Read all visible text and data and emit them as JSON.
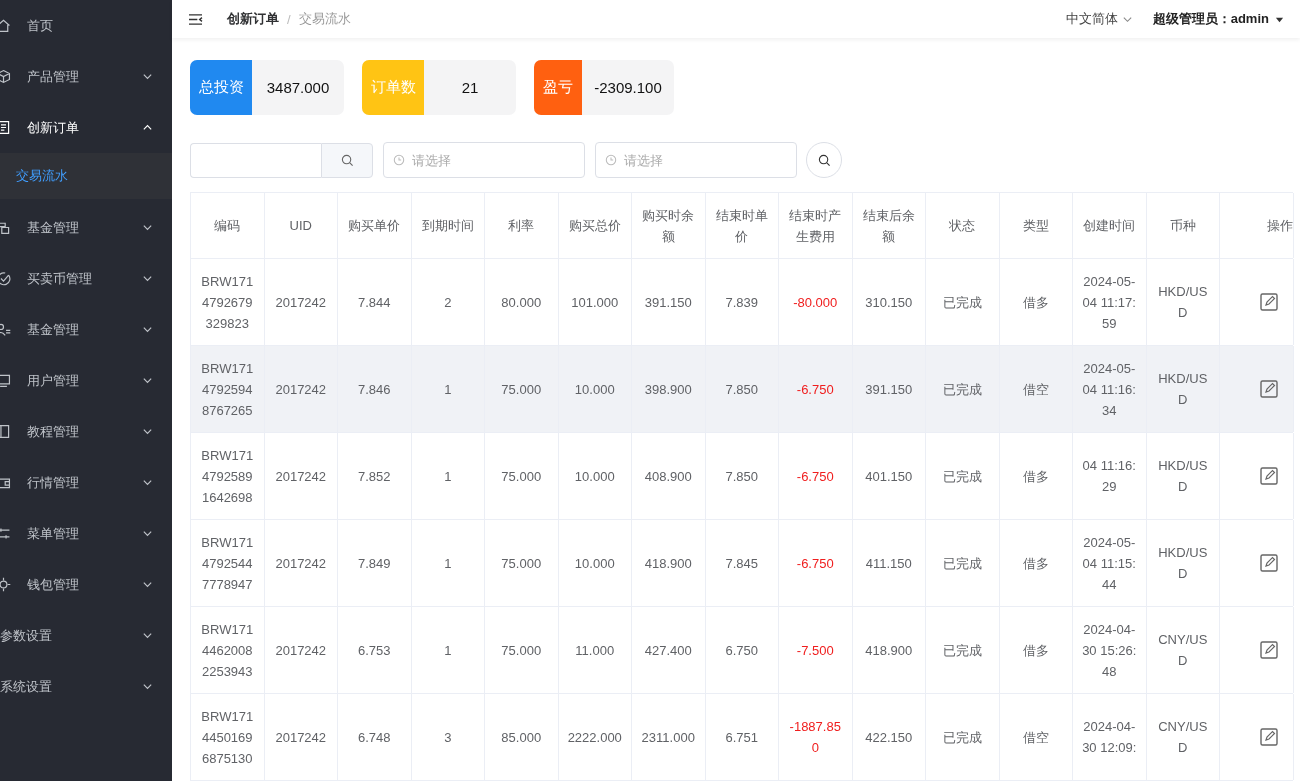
{
  "sidebar": {
    "items": [
      {
        "label": "首页",
        "expanded": false,
        "kind": "link"
      },
      {
        "label": "产品管理",
        "expanded": false,
        "kind": "submenu"
      },
      {
        "label": "创新订单",
        "expanded": true,
        "kind": "submenu",
        "children": [
          {
            "label": "交易流水",
            "selected": true
          }
        ]
      },
      {
        "label": "基金管理",
        "expanded": false,
        "kind": "submenu"
      },
      {
        "label": "买卖币管理",
        "expanded": false,
        "kind": "submenu"
      },
      {
        "label": "基金管理",
        "expanded": false,
        "kind": "submenu"
      },
      {
        "label": "用户管理",
        "expanded": false,
        "kind": "submenu"
      },
      {
        "label": "教程管理",
        "expanded": false,
        "kind": "submenu"
      },
      {
        "label": "行情管理",
        "expanded": false,
        "kind": "submenu"
      },
      {
        "label": "菜单管理",
        "expanded": false,
        "kind": "submenu"
      },
      {
        "label": "钱包管理",
        "expanded": false,
        "kind": "submenu"
      },
      {
        "label": "参数设置",
        "expanded": false,
        "kind": "submenu"
      },
      {
        "label": "系统设置",
        "expanded": false,
        "kind": "submenu"
      }
    ]
  },
  "breadcrumb": {
    "items": [
      "创新订单",
      "交易流水"
    ],
    "separator": "/"
  },
  "header": {
    "language": "中文简体",
    "user": "超级管理员：admin"
  },
  "stats": [
    {
      "label": "总投资",
      "value": "3487.000",
      "color": "#2089f0"
    },
    {
      "label": "订单数",
      "value": "21",
      "color": "#ffc414"
    },
    {
      "label": "盈亏",
      "value": "-2309.100",
      "color": "#ff6010"
    }
  ],
  "filters": {
    "date_start": {
      "placeholder": "请选择"
    },
    "date_end": {
      "placeholder": "请选择"
    }
  },
  "table": {
    "columns": [
      "编码",
      "UID",
      "购买单价",
      "到期时间",
      "利率",
      "购买总价",
      "购买时余额",
      "结束时单价",
      "结束时产生费用",
      "结束后余额",
      "状态",
      "类型",
      "创建时间",
      "币种",
      "操作"
    ],
    "rows": [
      {
        "highlighted": false,
        "cells": [
          "BRW1714792679329823",
          "2017242",
          "7.844",
          "2",
          "80.000",
          "101.000",
          "391.150",
          "7.839",
          "-80.000",
          "310.150",
          "已完成",
          "借多",
          "2024-05-04 11:17:59",
          "HKD/USD"
        ]
      },
      {
        "highlighted": true,
        "cells": [
          "BRW17147925948767265",
          "2017242",
          "7.846",
          "1",
          "75.000",
          "10.000",
          "398.900",
          "7.850",
          "-6.750",
          "391.150",
          "已完成",
          "借空",
          "2024-05-04 11:16:34",
          "HKD/USD"
        ]
      },
      {
        "highlighted": false,
        "cells": [
          "BRW17147925891642698",
          "2017242",
          "7.852",
          "1",
          "75.000",
          "10.000",
          "408.900",
          "7.850",
          "-6.750",
          "401.150",
          "已完成",
          "借多",
          "04 11:16:29",
          "HKD/USD"
        ]
      },
      {
        "highlighted": false,
        "cells": [
          "BRW17147925447778947",
          "2017242",
          "7.849",
          "1",
          "75.000",
          "10.000",
          "418.900",
          "7.845",
          "-6.750",
          "411.150",
          "已完成",
          "借多",
          "2024-05-04 11:15:44",
          "HKD/USD"
        ]
      },
      {
        "highlighted": false,
        "cells": [
          "BRW17144620082253943",
          "2017242",
          "6.753",
          "1",
          "75.000",
          "11.000",
          "427.400",
          "6.750",
          "-7.500",
          "418.900",
          "已完成",
          "借多",
          "2024-04-30 15:26:48",
          "CNY/USD"
        ]
      },
      {
        "highlighted": false,
        "cells": [
          "BRW17144501696875130",
          "2017242",
          "6.748",
          "3",
          "85.000",
          "2222.000",
          "2311.000",
          "6.751",
          "-1887.850",
          "422.150",
          "已完成",
          "借空",
          "2024-04-30 12:09:",
          "CNY/USD"
        ]
      }
    ]
  }
}
